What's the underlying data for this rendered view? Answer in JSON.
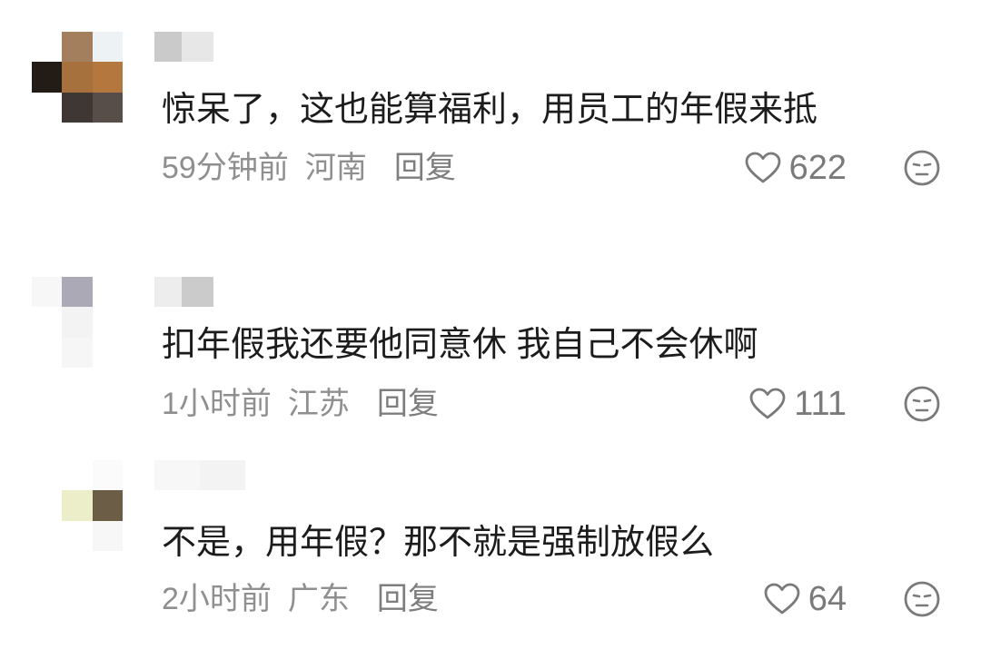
{
  "icons": {
    "like": "heart-icon",
    "dislike": "expressionless-face-icon"
  },
  "comments": [
    {
      "text": "惊呆了，这也能算福利，用员工的年假来抵",
      "time": "59分钟前",
      "location": "河南",
      "reply_label": "回复",
      "likes": 622
    },
    {
      "text": "扣年假我还要他同意休 我自己不会休啊",
      "time": "1小时前",
      "location": "江苏",
      "reply_label": "回复",
      "likes": 111
    },
    {
      "text": "不是，用年假？那不就是强制放假么",
      "time": "2小时前",
      "location": "广东",
      "reply_label": "回复",
      "likes": 64
    }
  ]
}
